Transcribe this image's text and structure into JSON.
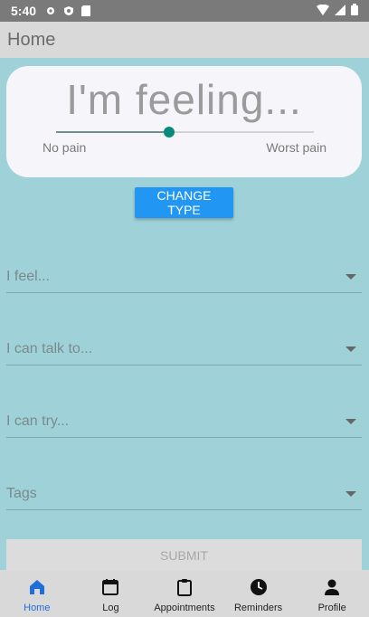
{
  "status_bar": {
    "time": "5:40"
  },
  "app_bar": {
    "title": "Home"
  },
  "card": {
    "title": "I'm feeling...",
    "slider": {
      "min_label": "No pain",
      "max_label": "Worst pain",
      "value": 0.44
    }
  },
  "change_type_label": "CHANGE TYPE",
  "dropdowns": [
    {
      "label": "I feel..."
    },
    {
      "label": "I can talk to..."
    },
    {
      "label": "I can try..."
    },
    {
      "label": "Tags"
    }
  ],
  "submit_label": "SUBMIT",
  "bottom_nav": {
    "items": [
      {
        "label": "Home",
        "icon": "home-icon",
        "active": true
      },
      {
        "label": "Log",
        "icon": "calendar-icon",
        "active": false
      },
      {
        "label": "Appointments",
        "icon": "clipboard-icon",
        "active": false
      },
      {
        "label": "Reminders",
        "icon": "clock-icon",
        "active": false
      },
      {
        "label": "Profile",
        "icon": "person-icon",
        "active": false
      }
    ]
  },
  "colors": {
    "background": "#9fd2d8",
    "accent": "#2196f3",
    "slider_thumb": "#0a8a7c",
    "active_nav": "#1e6fd9"
  }
}
